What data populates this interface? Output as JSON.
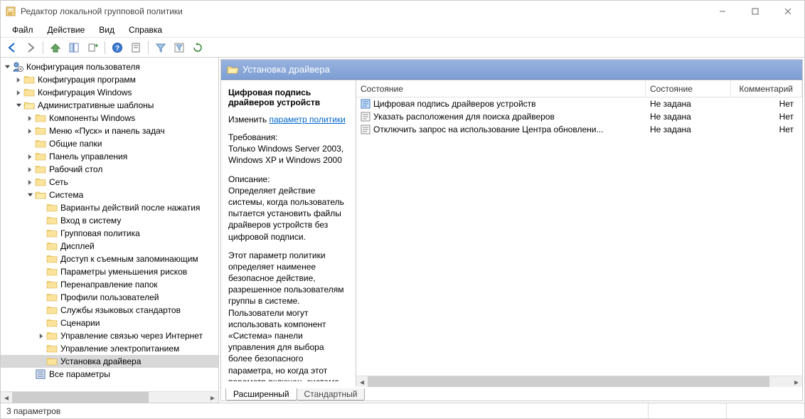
{
  "window": {
    "title": "Редактор локальной групповой политики"
  },
  "menu": {
    "file": "Файл",
    "action": "Действие",
    "view": "Вид",
    "help": "Справка"
  },
  "tree": {
    "root": "Конфигурация пользователя",
    "progConfig": "Конфигурация программ",
    "winConfig": "Конфигурация Windows",
    "adminTmpl": "Административные шаблоны",
    "winComp": "Компоненты Windows",
    "startMenu": "Меню «Пуск» и панель задач",
    "sharedFolders": "Общие папки",
    "controlPanel": "Панель управления",
    "desktop": "Рабочий стол",
    "network": "Сеть",
    "system": "Система",
    "sys_actions": "Варианты действий после нажатия",
    "sys_logon": "Вход в систему",
    "sys_gp": "Групповая политика",
    "sys_display": "Дисплей",
    "sys_removable": "Доступ к съемным запоминающим",
    "sys_mitigation": "Параметры уменьшения рисков",
    "sys_folderRedir": "Перенаправление папок",
    "sys_userProfiles": "Профили пользователей",
    "sys_langServices": "Службы языковых стандартов",
    "sys_scripts": "Сценарии",
    "sys_inet": "Управление связью через Интернет",
    "sys_power": "Управление электропитанием",
    "sys_driverInstall": "Установка драйвера",
    "allSettings": "Все параметры"
  },
  "paneHeader": "Установка драйвера",
  "detail": {
    "title": "Цифровая подпись драйверов устройств",
    "editLabel": "Изменить",
    "editLink": "параметр политики",
    "reqLabel": "Требования:",
    "reqText": "Только Windows Server 2003, Windows XP и Windows 2000",
    "descLabel": "Описание:",
    "descText1": "Определяет действие системы, когда пользователь пытается установить файлы драйверов устройств без цифровой подписи.",
    "descText2": "Этот параметр политики определяет наименее безопасное действие, разрешенное пользователям группы в системе. Пользователи могут использовать компонент «Система» панели управления для выбора более безопасного параметра, но когда этот параметр включен, система не разрешит никакие менее безопасные параметры,"
  },
  "grid": {
    "colState": "Состояние",
    "colStateP": "Состояние",
    "colComment": "Комментарий",
    "rows": [
      {
        "name": "Цифровая подпись драйверов устройств",
        "state": "Не задана",
        "comment": "Нет",
        "highlight": true
      },
      {
        "name": "Указать расположения для поиска драйверов",
        "state": "Не задана",
        "comment": "Нет",
        "highlight": false
      },
      {
        "name": "Отключить запрос на использование Центра обновлени...",
        "state": "Не задана",
        "comment": "Нет",
        "highlight": false
      }
    ]
  },
  "tabs": {
    "extended": "Расширенный",
    "standard": "Стандартный"
  },
  "status": {
    "text": "3 параметров"
  }
}
